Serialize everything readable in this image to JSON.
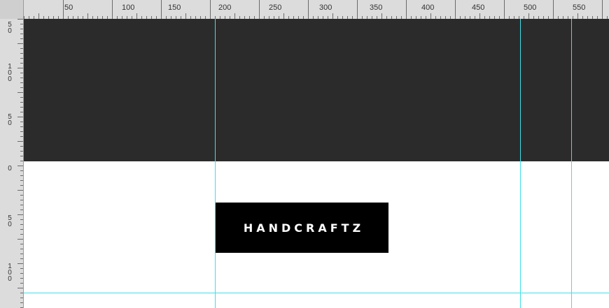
{
  "ruler": {
    "top_labels": [
      "50",
      "100",
      "150",
      "200",
      "250",
      "300",
      "350",
      "400",
      "450",
      "500",
      "550"
    ],
    "left_labels": [
      "5\n0",
      "1\n0\n0",
      "5\n0",
      "0",
      "5\n0",
      "1\n0\n0"
    ]
  },
  "canvas": {
    "logo_text": "HANDCRAFTZ"
  },
  "colors": {
    "dark_band": "#2b2b2b",
    "guide": "#3fe0e8",
    "logo_bg": "#000000",
    "logo_text": "#ffffff"
  }
}
